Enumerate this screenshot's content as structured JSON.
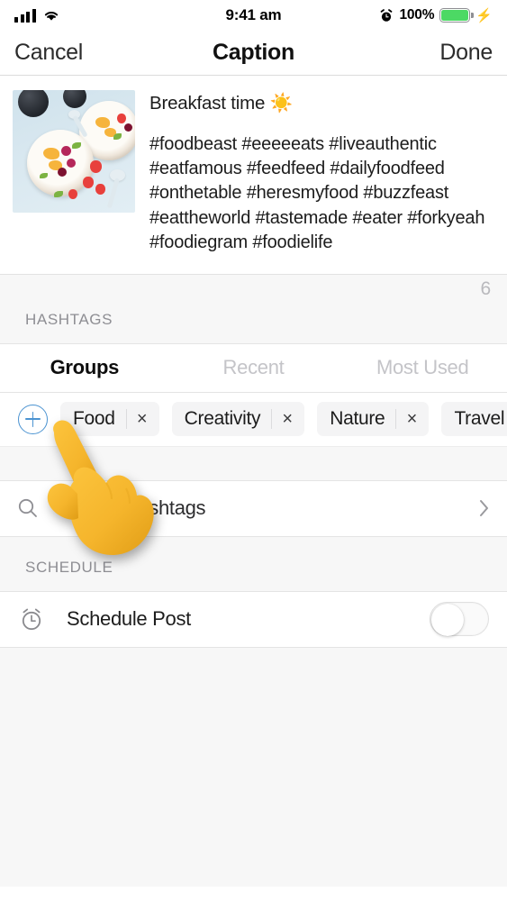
{
  "status_bar": {
    "signal_icon": "cellular-signal-icon",
    "wifi_icon": "wifi-icon",
    "time": "9:41 am",
    "alarm_icon": "alarm-clock-icon",
    "battery_percent": "100%",
    "battery_icon": "battery-full-icon",
    "charging_icon": "lightning-bolt-icon",
    "battery_color": "#4cd964"
  },
  "nav_bar": {
    "cancel_label": "Cancel",
    "title": "Caption",
    "done_label": "Done"
  },
  "caption_card": {
    "thumbnail_alt": "breakfast-bowls-photo",
    "title": "Breakfast time ☀️",
    "hashtags": "#foodbeast #eeeeeats #liveauthentic #eatfamous #feedfeed #dailyfoodfeed #onthetable #heresmyfood #buzzfeast #eattheworld #tastemade #eater #forkyeah #foodiegram #foodielife"
  },
  "hashtags_section": {
    "count": "6",
    "header": "HASHTAGS",
    "tabs": [
      {
        "label": "Groups",
        "active": true
      },
      {
        "label": "Recent",
        "active": false
      },
      {
        "label": "Most Used",
        "active": false
      }
    ],
    "add_button_icon": "plus-circle-icon",
    "add_button_color": "#4b93d1",
    "groups": [
      {
        "label": "Food",
        "remove_icon": "×"
      },
      {
        "label": "Creativity",
        "remove_icon": "×"
      },
      {
        "label": "Nature",
        "remove_icon": "×"
      },
      {
        "label": "Travel",
        "remove_icon": "×"
      }
    ],
    "search_row": {
      "icon": "search-icon",
      "label": "Search Hashtags",
      "disclosure_icon": "chevron-right-icon"
    }
  },
  "schedule_section": {
    "header": "SCHEDULE",
    "row": {
      "icon": "alarm-clock-icon",
      "label": "Schedule Post",
      "toggle_state": "off"
    }
  },
  "overlay": {
    "pointer_icon": "pointing-hand-up-emoji"
  }
}
